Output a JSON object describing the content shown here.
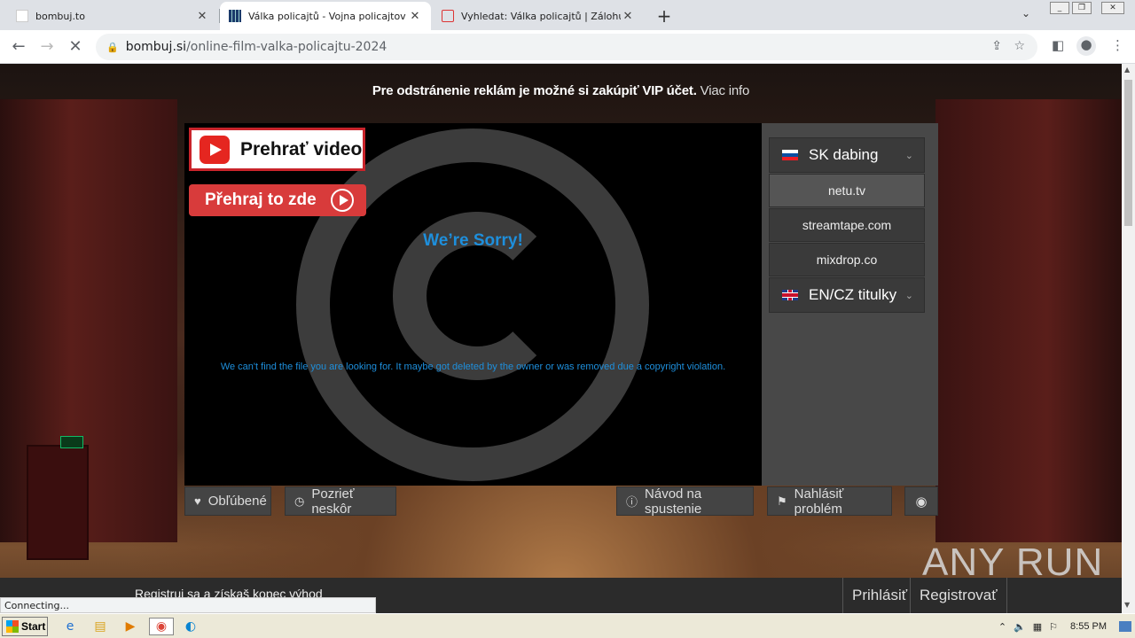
{
  "browser": {
    "tabs": [
      {
        "title": "bombuj.to",
        "active": false
      },
      {
        "title": "Válka policajtů - Vojna policajtov onli",
        "active": true
      },
      {
        "title": "Vyhledat: Válka policajtů | Zálohuj.si",
        "active": false
      }
    ],
    "new_tab_label": "+",
    "url_host": "bombuj.si",
    "url_path": "/online-film-valka-policajtu-2024"
  },
  "page": {
    "promo_text": "Pre odstránenie reklám je možné si zakúpiť VIP účet.",
    "promo_link": "Viac info",
    "ad_play_video": "Prehrať video",
    "ad_play_here": "Přehraj to zde",
    "sorry_title": "We’re Sorry!",
    "sorry_message": "We can't find the file you are looking for. It maybe got deleted by the owner or was removed due a copyright violation.",
    "sources": {
      "group1": "SK dabing",
      "items": [
        "netu.tv",
        "streamtape.com",
        "mixdrop.co"
      ],
      "group2": "EN/CZ titulky"
    },
    "actions": {
      "favorite": "Obľúbené",
      "watch_later": "Pozrieť neskôr",
      "guide": "Návod na spustenie",
      "report": "Nahlásiť problém"
    },
    "bottom": {
      "register_text": "Registruj sa a získaš kopec výhod",
      "login": "Prihlásiť",
      "register": "Registrovať"
    },
    "watermark": "ANY RUN"
  },
  "status_text": "Connecting...",
  "taskbar": {
    "start": "Start",
    "clock": "8:55 PM"
  }
}
